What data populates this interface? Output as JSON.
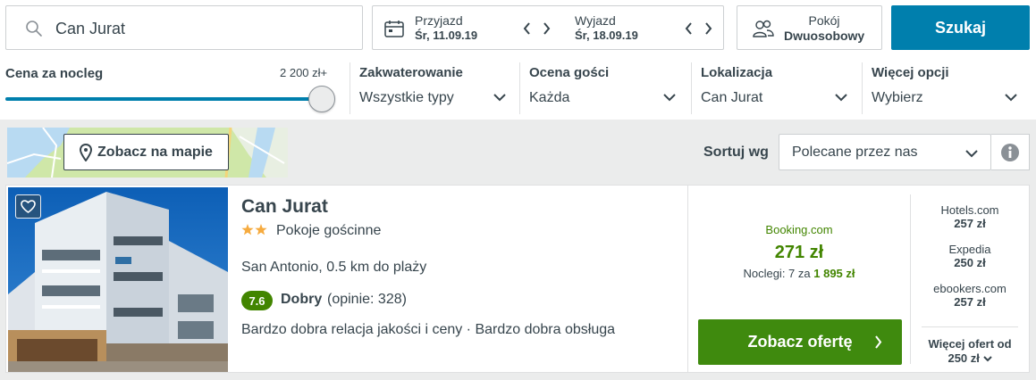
{
  "search": {
    "destination_value": "Can Jurat",
    "checkin_label": "Przyjazd",
    "checkin_value": "Śr, 11.09.19",
    "checkout_label": "Wyjazd",
    "checkout_value": "Śr, 18.09.19",
    "room_label": "Pokój",
    "room_value": "Dwuosobowy",
    "search_button": "Szukaj"
  },
  "filters": {
    "price_title": "Cena za nocleg",
    "price_max": "2 200 zł+",
    "price_slider_fraction": 1.0,
    "items": [
      {
        "title": "Zakwaterowanie",
        "value": "Wszystkie typy"
      },
      {
        "title": "Ocena gości",
        "value": "Każda"
      },
      {
        "title": "Lokalizacja",
        "value": "Can Jurat"
      },
      {
        "title": "Więcej opcji",
        "value": "Wybierz"
      }
    ]
  },
  "toolbar": {
    "map_button": "Zobacz na mapie",
    "sort_label": "Sortuj wg",
    "sort_value": "Polecane przez nas"
  },
  "hotel": {
    "name": "Can Jurat",
    "stars": 2,
    "type": "Pokoje gościnne",
    "location": "San Antonio, 0.5 km do plaży",
    "rating_score": "7.6",
    "rating_word": "Dobry",
    "rating_count": "(opinie: 328)",
    "highlights": "Bardzo dobra relacja jakości i ceny · Bardzo dobra obsługa",
    "deal": {
      "site": "Booking.com",
      "price": "271 zł",
      "nights_prefix": "Noclegi: 7 za",
      "nights_total": "1 895 zł",
      "button": "Zobacz ofertę"
    },
    "other_offers": [
      {
        "site": "Hotels.com",
        "price": "257 zł"
      },
      {
        "site": "Expedia",
        "price": "250 zł"
      },
      {
        "site": "ebookers.com",
        "price": "257 zł"
      }
    ],
    "more_offers_label": "Więcej ofert od",
    "more_offers_price": "250 zł"
  },
  "colors": {
    "brand_blue": "#007fad",
    "deal_green": "#428500",
    "button_green": "#3f8a0e",
    "text": "#37454d",
    "star": "#f6ab3f"
  }
}
